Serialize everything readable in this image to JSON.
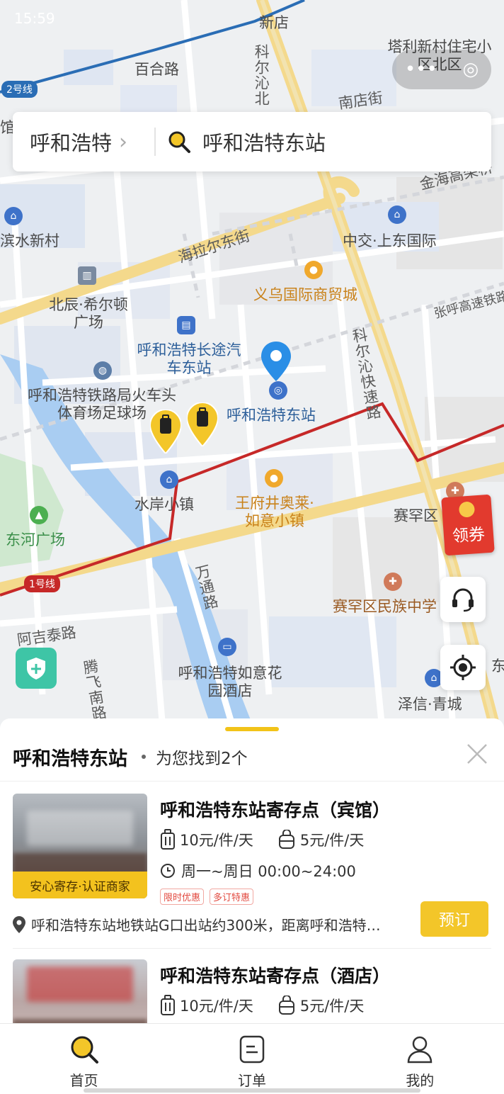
{
  "status_bar": {
    "time": "15:59"
  },
  "search": {
    "city": "呼和浩特",
    "query": "呼和浩特东站"
  },
  "map": {
    "labels": {
      "xindian": "新店",
      "baihelu": "百合路",
      "tali": "塔利新村住宅小区北区",
      "keerqin_bei": "科尔沁北",
      "nandianjie": "南店街",
      "guan": "馆",
      "jinhai": "金海高架桥",
      "binshui": "滨水新村",
      "zhongjiao": "中交·上东国际",
      "hailaer": "海拉尔东街",
      "yiwu": "义乌国际商贸城",
      "beichen": "北辰·希尔顿广场",
      "zhanghu": "张呼高速铁路",
      "changtu": "呼和浩特长途汽车东站",
      "keerqin_kuaisu": "科尔沁快速路",
      "tieluju": "呼和浩特铁路局火车头体育场足球场",
      "dongzhan": "呼和浩特东站",
      "shuian": "水岸小镇",
      "wangfujing": "王府井奥莱·如意小镇",
      "saihan": "赛罕区",
      "donghe": "东河广场",
      "saihan_school": "赛罕区民族中学",
      "wantong": "万通路",
      "ajitai": "阿吉泰路",
      "tengfei": "腾飞南路",
      "ruyi_hotel": "呼和浩特如意花园酒店",
      "zexin": "泽信·青城",
      "edge_dong": "东"
    },
    "lines": {
      "line1": "1号线",
      "line2": "2号线"
    },
    "coupon": "领券"
  },
  "sheet": {
    "title": "呼和浩特东站",
    "found": "为您找到2个",
    "cards": [
      {
        "title": "呼和浩特东站寄存点（宾馆）",
        "price_large": "10元/件/天",
        "price_small": "5元/件/天",
        "hours": "周一~周日 00:00~24:00",
        "badge": "安心寄存·认证商家",
        "tags": [
          "限时优惠",
          "多订特惠"
        ],
        "address": "呼和浩特东站地铁站G口出站约300米，距离呼和浩特…",
        "book": "预订"
      },
      {
        "title": "呼和浩特东站寄存点（酒店）",
        "price_large": "10元/件/天",
        "price_small": "5元/件/天"
      }
    ]
  },
  "tabs": [
    {
      "label": "首页",
      "icon": "search-icon"
    },
    {
      "label": "订单",
      "icon": "order-icon"
    },
    {
      "label": "我的",
      "icon": "person-icon"
    }
  ],
  "colors": {
    "accent": "#f3c629",
    "metro_red": "#c62828",
    "metro_blue": "#2a6db5",
    "coupon_red": "#e23a2e"
  }
}
